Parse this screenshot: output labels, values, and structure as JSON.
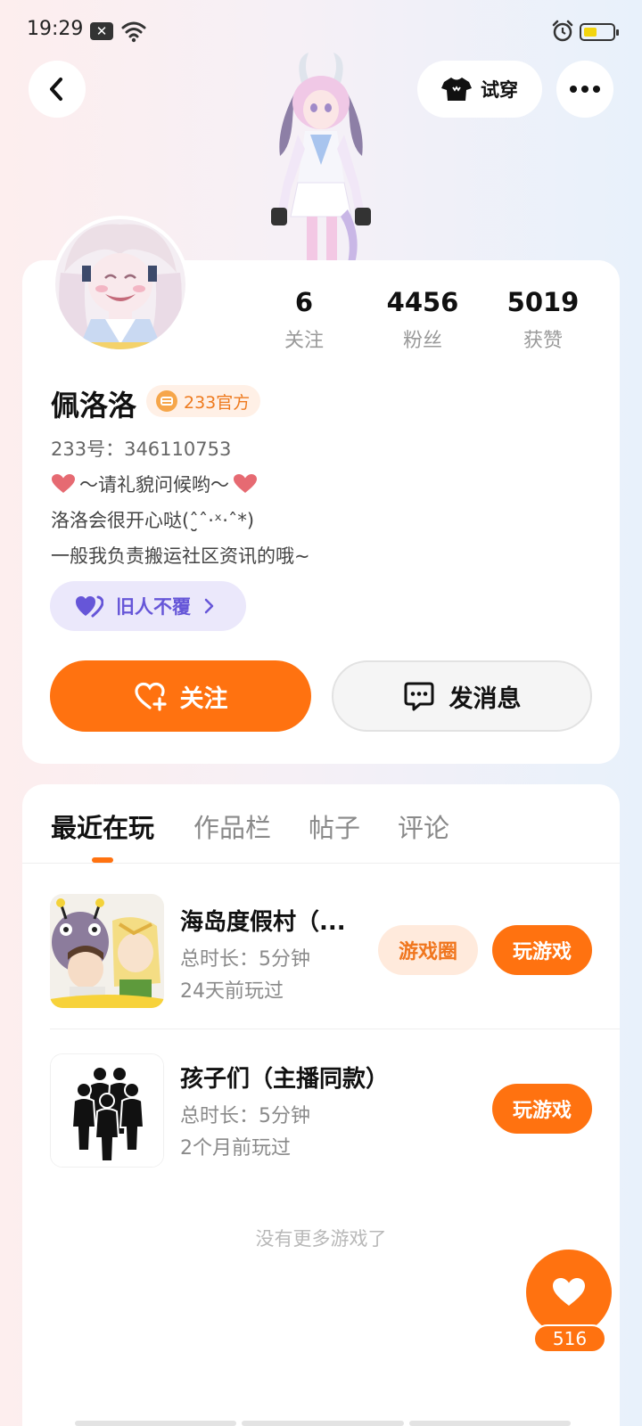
{
  "status_bar": {
    "time": "19:29",
    "notification_glyph": "x-icon",
    "battery_color": "#f2d40e"
  },
  "nav": {
    "try_on_label": "试穿"
  },
  "profile": {
    "stats": [
      {
        "value": "6",
        "label": "关注"
      },
      {
        "value": "4456",
        "label": "粉丝"
      },
      {
        "value": "5019",
        "label": "获赞"
      }
    ],
    "name": "佩洛洛",
    "badge": "233官方",
    "id_text": "233号：346110753",
    "bio": [
      "～请礼貌问候哟～",
      "洛洛会很开心哒(ˆ̮̮ˆ·ˣ·ˆ*)",
      "一般我负责搬运社区资讯的哦~"
    ],
    "relation": "旧人不覆",
    "follow_label": "关注",
    "message_label": "发消息"
  },
  "tabs": [
    "最近在玩",
    "作品栏",
    "帖子",
    "评论"
  ],
  "games": [
    {
      "title": "海岛度假村（...",
      "duration": "总时长：5分钟",
      "last_played": "24天前玩过",
      "circle_label": "游戏圈",
      "play_label": "玩游戏"
    },
    {
      "title": "孩子们（主播同款）",
      "duration": "总时长：5分钟",
      "last_played": "2个月前玩过",
      "play_label": "玩游戏"
    }
  ],
  "no_more_text": "没有更多游戏了",
  "like_count": "516",
  "colors": {
    "accent": "#ff7210",
    "badge_text": "#ee7a1e",
    "relation_text": "#6656d8"
  }
}
